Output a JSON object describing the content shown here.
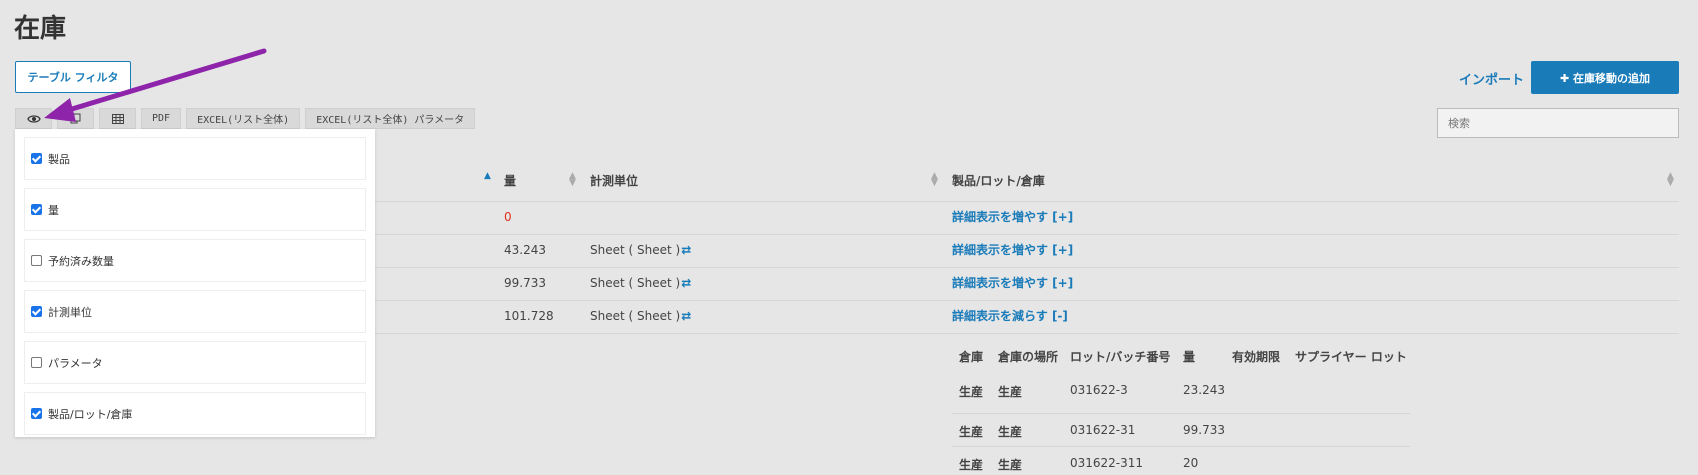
{
  "page": {
    "title": "在庫"
  },
  "actions": {
    "table_filter": "テーブル フィルタ",
    "import": "インポート",
    "add_stock_move": "✚ 在庫移動の追加",
    "search_placeholder": "検索"
  },
  "toolbar": {
    "visibility_icon": "eye-icon",
    "copy_icon": "copy-icon",
    "table_icon": "table-icon",
    "pdf": "PDF",
    "excel_all": "EXCEL(リスト全体)",
    "excel_all_params": "EXCEL(リスト全体) パラメータ"
  },
  "table": {
    "headers": {
      "quantity": "量",
      "unit": "計測単位",
      "product_lot_warehouse": "製品/ロット/倉庫"
    },
    "rows": [
      {
        "quantity": "0",
        "unit": "",
        "swap": "",
        "link": "詳細表示を増やす [+]"
      },
      {
        "quantity": "43.243",
        "unit": "Sheet ( Sheet )",
        "swap": "⇄",
        "link": "詳細表示を増やす [+]"
      },
      {
        "quantity": "99.733",
        "unit": "Sheet ( Sheet )",
        "swap": "⇄",
        "link": "詳細表示を増やす [+]"
      },
      {
        "quantity": "101.728",
        "unit": "Sheet ( Sheet )",
        "swap": "⇄",
        "link": "詳細表示を減らす [-]"
      }
    ]
  },
  "subtable": {
    "headers": [
      "倉庫",
      "倉庫の場所",
      "ロット/バッチ番号",
      "量",
      "有効期限",
      "サプライヤー ロット"
    ],
    "rows": [
      {
        "warehouse": "生産",
        "location": "生産",
        "lot": "031622-3",
        "quantity": "23.243"
      },
      {
        "warehouse": "生産",
        "location": "生産",
        "lot": "031622-31",
        "quantity": "99.733"
      },
      {
        "warehouse": "生産",
        "location": "生産",
        "lot": "031622-311",
        "quantity": "20"
      }
    ]
  },
  "column_panel": {
    "items": [
      {
        "label": "製品",
        "checked": true
      },
      {
        "label": "量",
        "checked": true
      },
      {
        "label": "予約済み数量",
        "checked": false
      },
      {
        "label": "計測単位",
        "checked": true
      },
      {
        "label": "パラメータ",
        "checked": false
      },
      {
        "label": "製品/ロット/倉庫",
        "checked": true
      }
    ]
  },
  "colors": {
    "accent": "#1a7bb9",
    "negative": "#e0301e",
    "annotation_arrow": "#8e24aa"
  }
}
